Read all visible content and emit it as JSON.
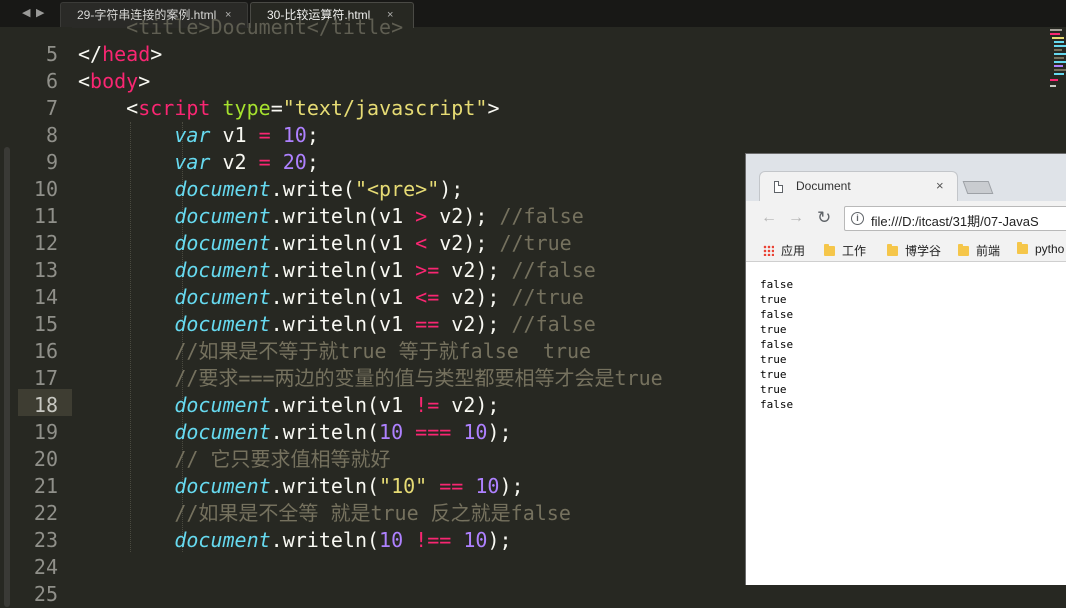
{
  "editor": {
    "tabs": [
      {
        "label": "29-字符串连接的案例.html",
        "close": "×"
      },
      {
        "label": "30-比较运算符.html",
        "close": "×"
      }
    ],
    "nav": {
      "back": "◀",
      "forward": "▶"
    },
    "line_numbers": [
      "5",
      "6",
      "7",
      "8",
      "9",
      "10",
      "11",
      "12",
      "13",
      "14",
      "15",
      "16",
      "17",
      "18",
      "19",
      "20",
      "21",
      "22",
      "23",
      "24",
      "25"
    ],
    "current_line": "18"
  },
  "browser": {
    "tab_title": "Document",
    "tab_close": "×",
    "url": "file:///D:/itcast/31期/07-JavaS",
    "bookmarks": [
      "应用",
      "工作",
      "博学谷",
      "前端",
      "pytho"
    ],
    "output_lines": [
      "false",
      "true",
      "false",
      "true",
      "false",
      "true",
      "true",
      "true",
      "false"
    ]
  },
  "colors": {
    "editor_bg": "#272822",
    "tag": "#f92672",
    "attribute": "#a6e22e",
    "string": "#e6db74",
    "number": "#ae81ff",
    "keyword": "#66d9ef",
    "comment": "#75715e"
  }
}
